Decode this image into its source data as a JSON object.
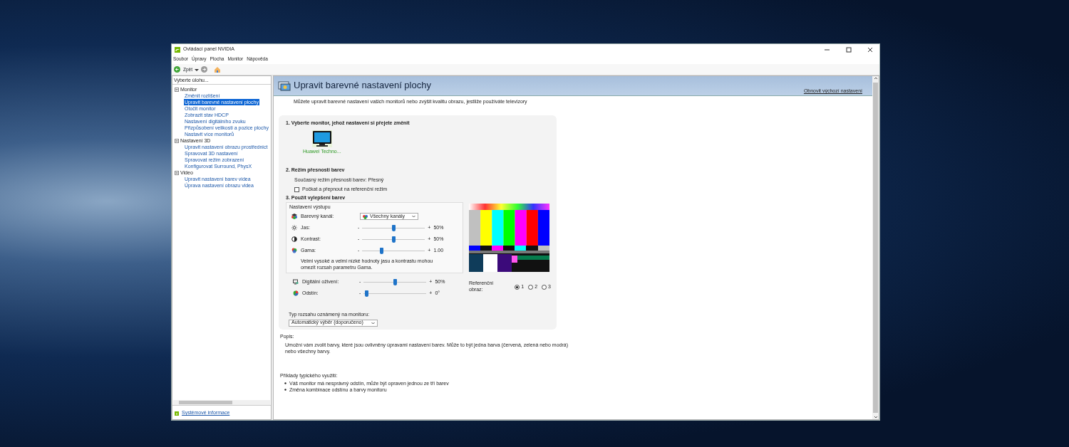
{
  "window": {
    "title": "Ovládací panel NVIDIA"
  },
  "menu": [
    "Soubor",
    "Úpravy",
    "Plocha",
    "Monitor",
    "Nápověda"
  ],
  "toolbar": {
    "back_label": "Zpět"
  },
  "sidebar": {
    "header": "Vyberte úlohu...",
    "tree": [
      {
        "label": "Monitor",
        "expanded": true,
        "children": [
          {
            "label": "Změnit rozlišení",
            "selected": false
          },
          {
            "label": "Upravit barevné nastavení plochy",
            "selected": true
          },
          {
            "label": "Otočit monitor",
            "selected": false
          },
          {
            "label": "Zobrazit stav HDCP",
            "selected": false
          },
          {
            "label": "Nastavení digitálního zvuku",
            "selected": false
          },
          {
            "label": "Přizpůsobení velikosti a pozice plochy",
            "selected": false
          },
          {
            "label": "Nastavit více monitorů",
            "selected": false
          }
        ]
      },
      {
        "label": "Nastavení 3D",
        "expanded": true,
        "children": [
          {
            "label": "Upravit nastavení obrazu prostřednict",
            "selected": false
          },
          {
            "label": "Spravovat 3D nastavení",
            "selected": false
          },
          {
            "label": "Spravovat režim zobrazení",
            "selected": false
          },
          {
            "label": "Konfigurovat Surround, PhysX",
            "selected": false
          }
        ]
      },
      {
        "label": "Video",
        "expanded": true,
        "children": [
          {
            "label": "Upravit nastavení barev videa",
            "selected": false
          },
          {
            "label": "Úprava nastavení obrazu videa",
            "selected": false
          }
        ]
      }
    ],
    "footer_link": "Systémové informace"
  },
  "page": {
    "title": "Upravit barevné nastavení plochy",
    "restore_link": "Obnovit výchozí nastavení",
    "intro": "Můžete upravit barevné nastavení vašich monitorů nebo zvýšit kvalitu obrazu, jestliže používáte televizory"
  },
  "section1": {
    "heading": "1. Vyberte monitor, jehož nastavení si přejete změnit",
    "monitors": [
      {
        "label": "Huawei Techno...",
        "selected": true
      }
    ]
  },
  "section2": {
    "heading": "2. Režim přesnosti barev",
    "current": "Současný režim přesnosti barev: Přesný",
    "checkbox": {
      "label": "Počkat a přepnout na referenční režim",
      "checked": false
    }
  },
  "section3": {
    "heading": "3. Použít vylepšení barev",
    "group_title": "Nastavení výstupu",
    "channel": {
      "label": "Barevný kanál:",
      "value": "Všechny kanály"
    },
    "sliders": [
      {
        "label": "Jas:",
        "min_sign": "-",
        "max_sign": "+",
        "level": 0.5,
        "reading": "50%"
      },
      {
        "label": "Kontrast:",
        "min_sign": "-",
        "max_sign": "+",
        "level": 0.5,
        "reading": "50%"
      },
      {
        "label": "Gama:",
        "min_sign": "-",
        "max_sign": "+",
        "level": 0.3,
        "reading": "1.00"
      }
    ],
    "note": "Velmi vysoké a velmi nízké hodnoty jasu a kontrastu mohou omezit rozsah parametru Gama.",
    "extra_sliders": [
      {
        "label": "Digitální oživení:",
        "min_sign": "-",
        "max_sign": "+",
        "level": 0.5,
        "reading": "50%"
      },
      {
        "label": "Odstín:",
        "min_sign": "-",
        "max_sign": "+",
        "level": 0.04,
        "reading": "0°"
      }
    ],
    "range_label": "Typ rozsahu oznámený na monitoru:",
    "range_value": "Automatický výběr (doporučeno)",
    "reference": {
      "label": "Referenční obraz:",
      "options": [
        {
          "label": "1",
          "selected": true
        },
        {
          "label": "2",
          "selected": false
        },
        {
          "label": "3",
          "selected": false
        }
      ]
    }
  },
  "description": {
    "heading": "Popis:",
    "text": "Umožní vám zvolit barvy, které jsou ovlivněny úpravami nastavení barev. Může to být jedna barva (červená, zelená nebo modrá) nebo všechny barvy."
  },
  "examples": {
    "heading": "Příklady typického využití:",
    "items": [
      "Váš monitor má nesprávný odstín, může být opraven jednou ze tří barev",
      "Změna kombinace odstínu a barvy monitoru"
    ]
  }
}
